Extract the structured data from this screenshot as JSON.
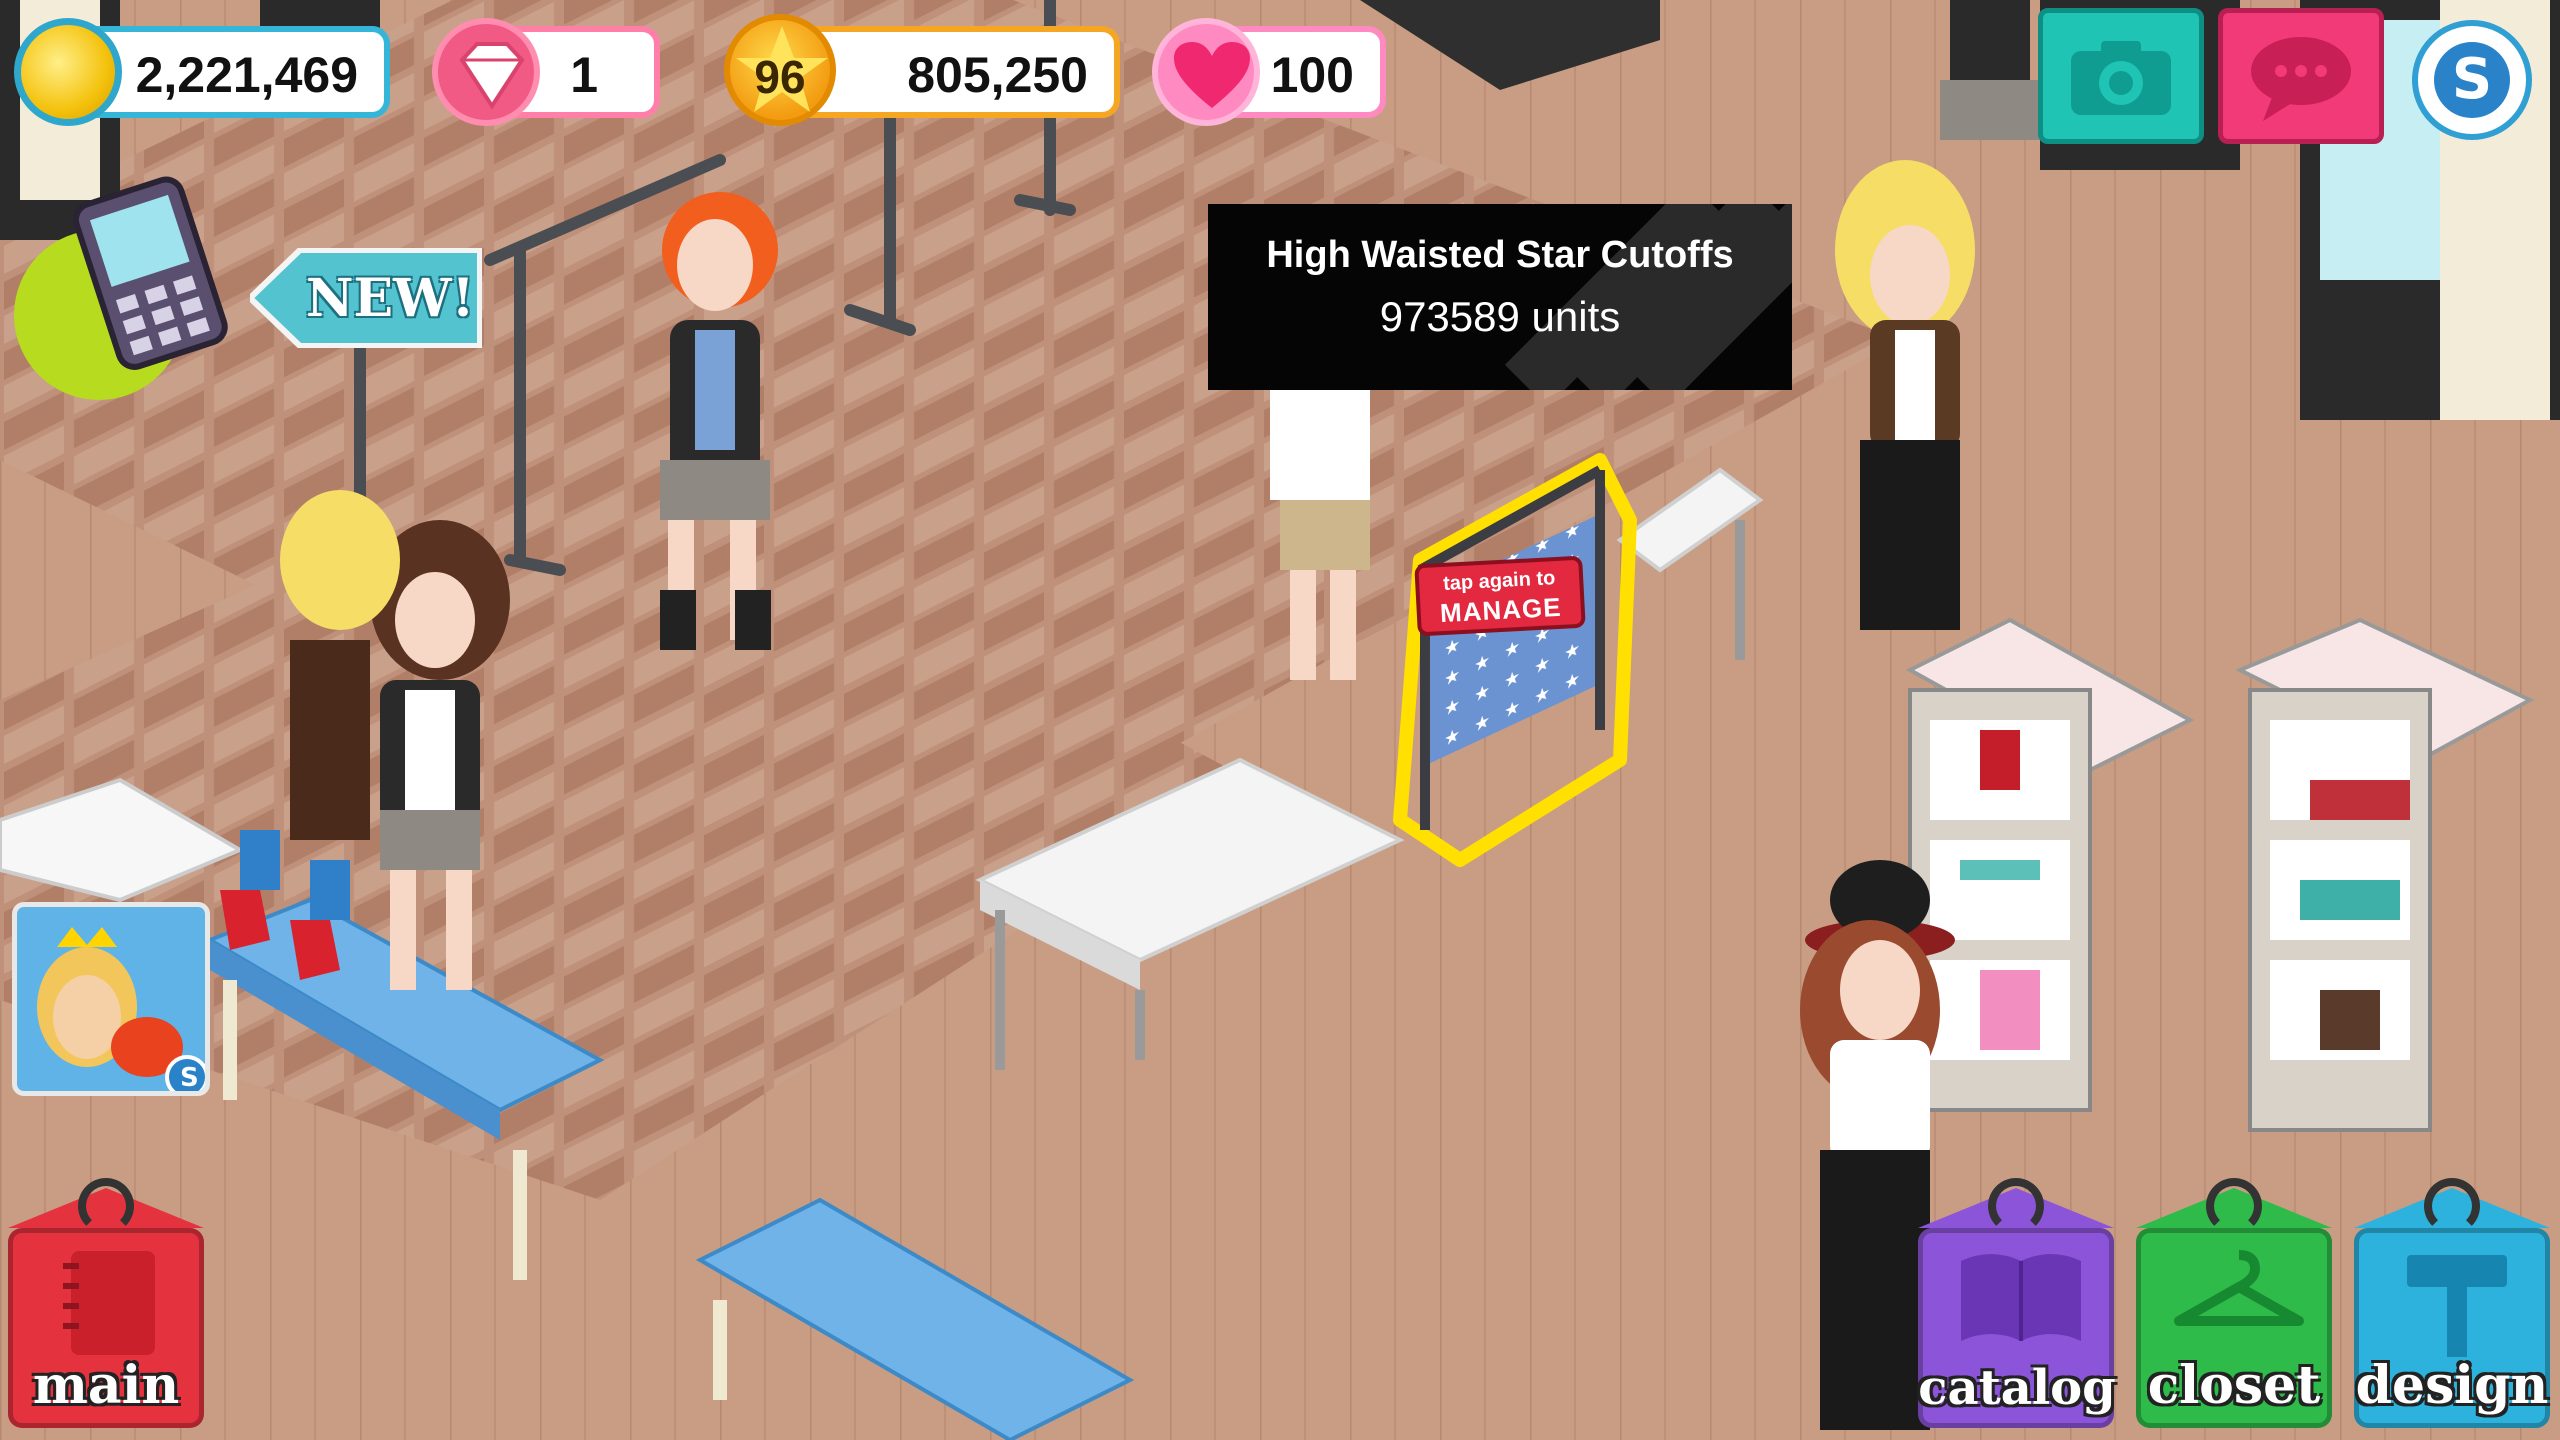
{
  "hud": {
    "coins": "2,221,469",
    "gems": "1",
    "level": "96",
    "xp": "805,250",
    "hearts": "100"
  },
  "tooltip": {
    "title": "High Waisted Star Cutoffs",
    "units": "973589 units"
  },
  "new_sign": "NEW!",
  "rack_label": {
    "line1": "tap again to",
    "line2": "MANAGE"
  },
  "nav_tags": {
    "main": "main",
    "catalog": "catalog",
    "closet": "closet",
    "design": "design"
  },
  "icons": {
    "coin": "coin-icon",
    "gem": "diamond-icon",
    "level": "star-icon",
    "heart": "heart-icon",
    "camera": "camera-icon",
    "chat": "chat-icon",
    "s_menu": "s-logo-icon",
    "phone": "phone-icon",
    "ad": "game-ad-icon"
  },
  "colors": {
    "floor": "#c69a7f",
    "tile": "#b5826a",
    "hud_border": "#35b6d8",
    "camera": "#1fc4b5",
    "chat": "#f23a79",
    "main_tag": "#e5323f",
    "catalog_tag": "#8c55d9",
    "closet_tag": "#2ebb4a",
    "design_tag": "#2cb2dd"
  }
}
